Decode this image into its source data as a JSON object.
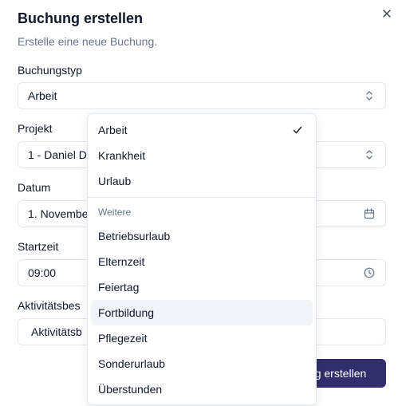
{
  "dialog": {
    "title": "Buchung erstellen",
    "description": "Erstelle eine neue Buchung.",
    "close_icon": "close-icon"
  },
  "form": {
    "booking_type": {
      "label": "Buchungstyp",
      "value": "Arbeit",
      "icon": "chevrons-up-down-icon"
    },
    "project": {
      "label": "Projekt",
      "value": "1 - Daniel D",
      "icon": "chevrons-up-down-icon"
    },
    "date": {
      "label": "Datum",
      "value": "1. Novembe",
      "icon": "calendar-icon"
    },
    "start_time": {
      "label": "Startzeit",
      "value": "09:00",
      "icon": "clock-icon"
    },
    "activity": {
      "label": "Aktivitätsbes",
      "placeholder": "Aktivitätsb"
    },
    "submit_label": "g erstellen"
  },
  "dropdown": {
    "primary": [
      {
        "label": "Arbeit",
        "selected": true
      },
      {
        "label": "Krankheit",
        "selected": false
      },
      {
        "label": "Urlaub",
        "selected": false
      }
    ],
    "group_label": "Weitere",
    "more": [
      {
        "label": "Betriebsurlaub",
        "highlighted": false
      },
      {
        "label": "Elternzeit",
        "highlighted": false
      },
      {
        "label": "Feiertag",
        "highlighted": false
      },
      {
        "label": "Fortbildung",
        "highlighted": true
      },
      {
        "label": "Pflegezeit",
        "highlighted": false
      },
      {
        "label": "Sonderurlaub",
        "highlighted": false
      },
      {
        "label": "Überstunden",
        "highlighted": false
      }
    ]
  },
  "colors": {
    "primary_button": "#312e6b",
    "border": "#e2e8f0",
    "muted_text": "#64748b",
    "highlight": "#f1f5f9"
  }
}
